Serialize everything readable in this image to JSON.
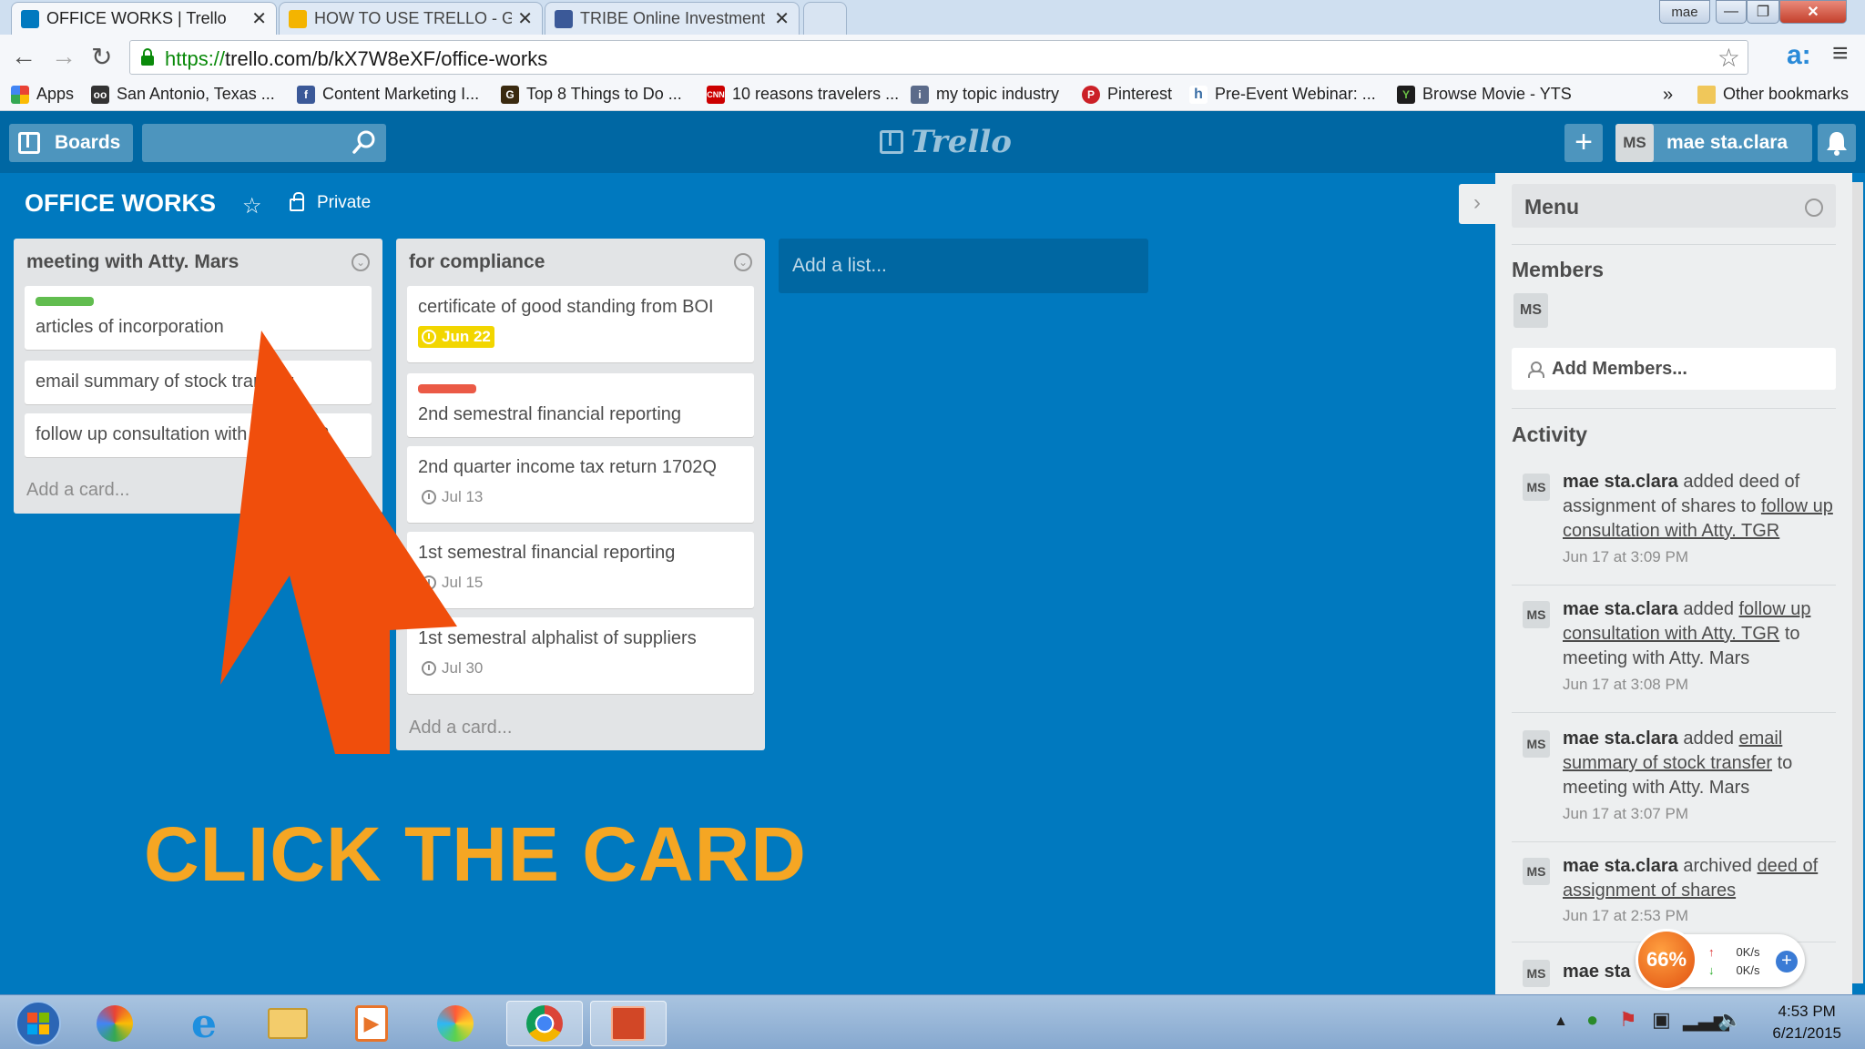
{
  "browser": {
    "tabs": [
      {
        "title": "OFFICE WORKS | Trello",
        "color": "#0079bf"
      },
      {
        "title": "HOW TO USE TRELLO - G",
        "color": "#f4b400"
      },
      {
        "title": "TRIBE Online Investment",
        "color": "#3b5998"
      }
    ],
    "profile": "mae",
    "close_glyph": "✕",
    "url_scheme": "https://",
    "url_rest": "trello.com/b/kX7W8eXF/office-works",
    "bookmarks": [
      {
        "label": "Apps"
      },
      {
        "label": "San Antonio, Texas ..."
      },
      {
        "label": "Content Marketing I..."
      },
      {
        "label": "Top 8 Things to Do ..."
      },
      {
        "label": "10 reasons travelers ..."
      },
      {
        "label": "my topic industry"
      },
      {
        "label": "Pinterest"
      },
      {
        "label": "Pre-Event Webinar: ..."
      },
      {
        "label": "Browse Movie - YTS"
      }
    ],
    "bookmarks_overflow": "»",
    "other_bookmarks": "Other bookmarks"
  },
  "header": {
    "boards_label": "Boards",
    "logo_text": "Trello",
    "user_initials": "MS",
    "user_name": "mae sta.clara"
  },
  "board": {
    "title": "OFFICE WORKS",
    "visibility": "Private"
  },
  "lists": [
    {
      "title": "meeting with Atty. Mars",
      "cards": [
        {
          "text": "articles of incorporation",
          "label_color": "#61bd4f"
        },
        {
          "text": "email summary of stock transfer"
        },
        {
          "text": "follow up consultation with Atty. TGR"
        }
      ],
      "add_card": "Add a card..."
    },
    {
      "title": "for compliance",
      "cards": [
        {
          "text": "certificate of good standing from BOI",
          "due": "Jun 22"
        },
        {
          "text": "2nd semestral financial reporting",
          "label_color": "#eb5a46"
        },
        {
          "text": "2nd quarter income tax return 1702Q",
          "due": "Jul 13"
        },
        {
          "text": "1st semestral financial reporting",
          "due": "Jul 15"
        },
        {
          "text": "1st semestral alphalist of suppliers",
          "due": "Jul 30"
        }
      ],
      "add_card": "Add a card..."
    }
  ],
  "add_list": "Add a list...",
  "overlay": {
    "caption": "CLICK THE CARD",
    "arrow_color": "#f04e0c",
    "caption_color": "#f5a623"
  },
  "sidebar": {
    "menu_title": "Menu",
    "members_title": "Members",
    "member_initials": "MS",
    "add_members": "Add Members...",
    "activity_title": "Activity",
    "activities": [
      {
        "initials": "MS",
        "user": "mae sta.clara",
        "verb1": " added deed of assignment of shares to ",
        "link1": "follow up consultation with Atty. TGR",
        "rest": "",
        "time": "Jun 17 at 3:09 PM"
      },
      {
        "initials": "MS",
        "user": "mae sta.clara",
        "verb1": " added ",
        "link1": "follow up consultation with Atty. TGR",
        "rest": " to meeting with Atty. Mars",
        "time": "Jun 17 at 3:08 PM"
      },
      {
        "initials": "MS",
        "user": "mae sta.clara",
        "verb1": " added ",
        "link1": "email summary of stock transfer",
        "rest": " to meeting with Atty. Mars",
        "time": "Jun 17 at 3:07 PM"
      },
      {
        "initials": "MS",
        "user": "mae sta.clara",
        "verb1": " archived ",
        "link1": "deed of assignment of shares",
        "rest": "",
        "time": "Jun 17 at 2:53 PM"
      }
    ],
    "partial_activity": {
      "initials": "MS",
      "user": "mae sta"
    }
  },
  "speed_widget": {
    "percent": "66%",
    "up": "0K/s",
    "down": "0K/s"
  },
  "taskbar": {
    "time": "4:53 PM",
    "date": "6/21/2015"
  }
}
